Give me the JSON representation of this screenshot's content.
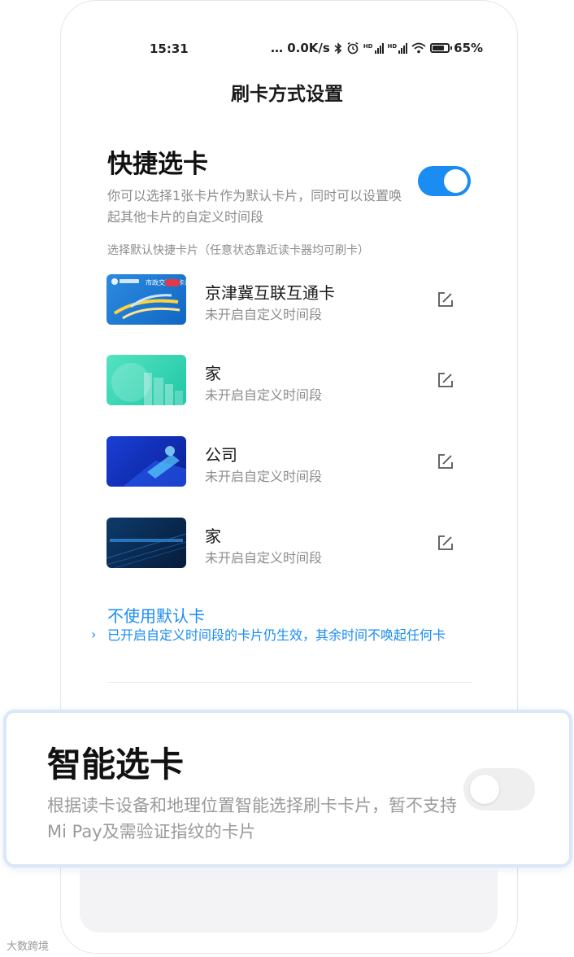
{
  "status_bar": {
    "time": "15:31",
    "network_speed": "… 0.0K/s",
    "icons": [
      "bluetooth-icon",
      "alarm-icon",
      "hd-signal-icon",
      "hd-signal-icon",
      "wifi-icon",
      "battery-icon"
    ],
    "battery": "65%",
    "hd_label": "HD"
  },
  "page_title": "刷卡方式设置",
  "quick_select": {
    "title": "快捷选卡",
    "description": "你可以选择1张卡片作为默认卡片，同时可以设置唤起其他卡片的自定义时间段",
    "toggle_on": true,
    "accent_color": "#1a8cf2",
    "hint": "选择默认快捷卡片（任意状态靠近读卡器均可刷卡）"
  },
  "cards": [
    {
      "name": "京津冀互联互通卡",
      "subtitle": "未开启自定义时间段",
      "card_label": "市政交通一卡通"
    },
    {
      "name": "家",
      "subtitle": "未开启自定义时间段"
    },
    {
      "name": "公司",
      "subtitle": "未开启自定义时间段"
    },
    {
      "name": "家",
      "subtitle": "未开启自定义时间段"
    }
  ],
  "no_default": {
    "title": "不使用默认卡",
    "description": "已开启自定义时间段的卡片仍生效，其余时间不唤起任何卡"
  },
  "smart_select": {
    "title": "智能选卡",
    "description": "根据读卡设备和地理位置智能选择刷卡卡片，暂不支持Mi Pay及需验证指纹的卡片",
    "toggle_on": false
  },
  "watermark": "大数跨境"
}
